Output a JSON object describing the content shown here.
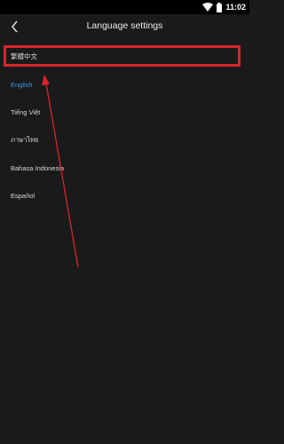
{
  "status_bar": {
    "time": "11:02",
    "icons": [
      "wifi-icon",
      "battery-icon"
    ]
  },
  "header": {
    "title": "Language settings",
    "back_icon": "chevron-left-icon"
  },
  "languages": [
    {
      "label": "繁體中文",
      "selected": false
    },
    {
      "label": "English",
      "selected": true
    },
    {
      "label": "Tiếng Việt",
      "selected": false
    },
    {
      "label": "ภาษาไทย",
      "selected": false
    },
    {
      "label": "Bahasa Indonesia",
      "selected": false
    },
    {
      "label": "Español",
      "selected": false
    }
  ],
  "colors": {
    "background": "#1a1a1a",
    "selected": "#3d9bf0",
    "annotation": "#d8262c"
  }
}
